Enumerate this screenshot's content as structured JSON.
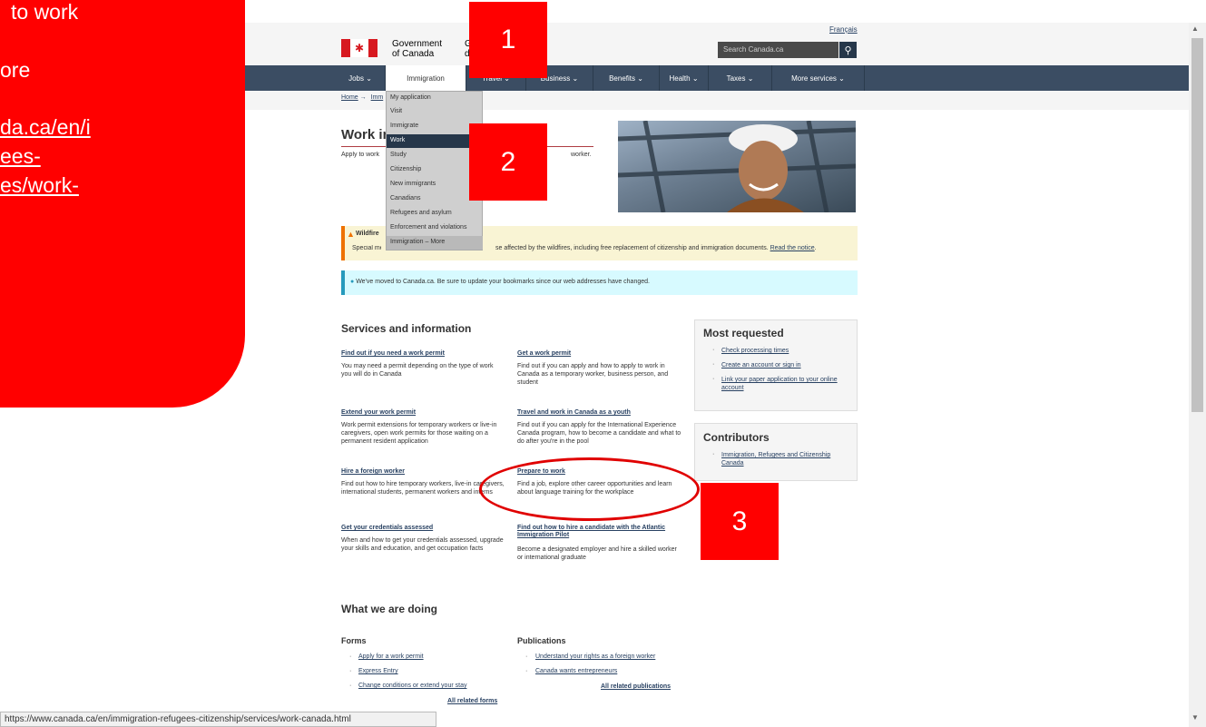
{
  "header": {
    "language_link": "Français",
    "gov_line1": "Government",
    "gov_line2": "of Canada",
    "gov_fr_line1": "G",
    "gov_fr_line2": "d",
    "search_placeholder": "Search Canada.ca",
    "search_icon": "search-icon"
  },
  "nav": {
    "items": [
      "Jobs ⌄",
      "Immigration",
      "Travel ⌄",
      "Business ⌄",
      "Benefits ⌄",
      "Health ⌄",
      "Taxes ⌄",
      "More services ⌄"
    ]
  },
  "breadcrumb": {
    "home": "Home",
    "arrow": "→",
    "next": "Imm"
  },
  "dropdown": {
    "items": [
      "My application",
      "Visit",
      "Immigrate",
      "Work",
      "Study",
      "Citizenship",
      "New immigrants",
      "Canadians",
      "Refugees and asylum",
      "Enforcement and violations",
      "Immigration – More"
    ]
  },
  "page": {
    "title": "Work in Canada",
    "intro_left": "Apply to work",
    "intro_right": "worker."
  },
  "alert": {
    "title": "Wildfire",
    "text_a": "Special me",
    "text_b": "se affected by the wildfires, including free replacement of citizenship and immigration documents.",
    "link": "Read the notice",
    "period": "."
  },
  "info": {
    "text": "We've moved to Canada.ca. Be sure to update your bookmarks since our web addresses have changed."
  },
  "services": {
    "heading": "Services and information",
    "items": [
      {
        "title": "Find out if you need a work permit",
        "desc": "You may need a permit depending on the type of work you will do in Canada"
      },
      {
        "title": "Get a work permit",
        "desc": "Find out if you can apply and how to apply to work in Canada as a temporary worker, business person, and student"
      },
      {
        "title": "Extend your work permit",
        "desc": "Work permit extensions for temporary workers or live-in caregivers, open work permits for those waiting on a permanent resident application"
      },
      {
        "title": "Travel and work in Canada as a youth",
        "desc": "Find out if you can apply for the International Experience Canada program, how to become a candidate and what to do after you're in the pool"
      },
      {
        "title": "Hire a foreign worker",
        "desc": "Find out how to hire temporary workers, live-in caregivers, international students, permanent workers and interns"
      },
      {
        "title": "Prepare to work",
        "desc": "Find a job, explore other career opportunities and learn about language training for the workplace"
      },
      {
        "title": "Get your credentials assessed",
        "desc": "When and how to get your credentials assessed, upgrade your skills and education, and get occupation facts"
      },
      {
        "title": "Find out how to hire a candidate with the Atlantic Immigration Pilot",
        "desc": "Become a designated employer and hire a skilled worker or international graduate"
      }
    ]
  },
  "most_requested": {
    "heading": "Most requested",
    "items": [
      "Check processing times",
      "Create an account or sign in",
      "Link your paper application to your online account"
    ]
  },
  "contributors": {
    "heading": "Contributors",
    "items": [
      "Immigration, Refugees and Citizenship Canada"
    ]
  },
  "doing": {
    "heading": "What we are doing",
    "forms_heading": "Forms",
    "forms": [
      "Apply for a work permit",
      "Express Entry",
      "Change conditions or extend your stay"
    ],
    "forms_all": "All related forms",
    "pubs_heading": "Publications",
    "pubs": [
      "Understand your rights as a foreign worker",
      "Canada wants entrepreneurs"
    ],
    "pubs_all": "All related publications"
  },
  "status_bar": {
    "url": "https://www.canada.ca/en/immigration-refugees-citizenship/services/work-canada.html"
  },
  "overlay": {
    "lines": [
      "to work",
      "",
      "ore",
      "",
      "da.ca/en/i",
      "ees-",
      "es/work-"
    ],
    "badges": [
      "1",
      "2",
      "3"
    ]
  },
  "colors": {
    "nav_bg": "#3b4d63",
    "overlay_red": "#ff0000",
    "link": "#284162"
  }
}
